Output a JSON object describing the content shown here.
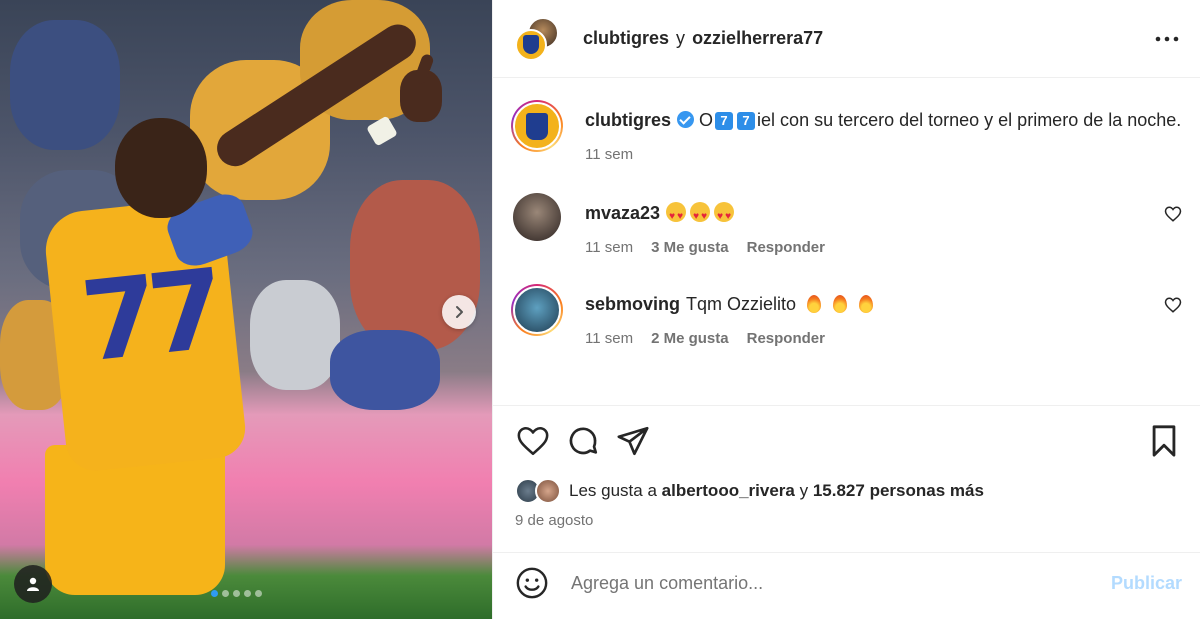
{
  "header": {
    "user1": "clubtigres",
    "separator": "y",
    "user2": "ozzielherrera77"
  },
  "caption": {
    "username": "clubtigres",
    "text_before": "O",
    "keycap_1": "7",
    "keycap_2": "7",
    "text_after": "iel con su tercero del torneo y el primero de la noche.",
    "time": "11 sem"
  },
  "comments": [
    {
      "username": "mvaza23",
      "text": "",
      "emoji": [
        "smiling-face-with-heart-eyes",
        "smiling-face-with-heart-eyes",
        "smiling-face-with-heart-eyes"
      ],
      "time": "11 sem",
      "likes": "3 Me gusta",
      "reply": "Responder"
    },
    {
      "username": "sebmoving",
      "text": "Tqm Ozzielito",
      "emoji": [
        "fire",
        "fire",
        "fire"
      ],
      "time": "11 sem",
      "likes": "2 Me gusta",
      "reply": "Responder"
    }
  ],
  "likes": {
    "prefix": "Les gusta a",
    "user": "albertooo_rivera",
    "conjunction": "y",
    "others": "15.827 personas más"
  },
  "date": "9 de agosto",
  "comment_box": {
    "placeholder": "Agrega un comentario...",
    "publish": "Publicar"
  },
  "carousel": {
    "slides": 5,
    "active_index": 0
  },
  "colors": {
    "verified": "#3797f0",
    "publish_disabled": "#b3dbff",
    "carousel_active": "#2f9bf3"
  }
}
